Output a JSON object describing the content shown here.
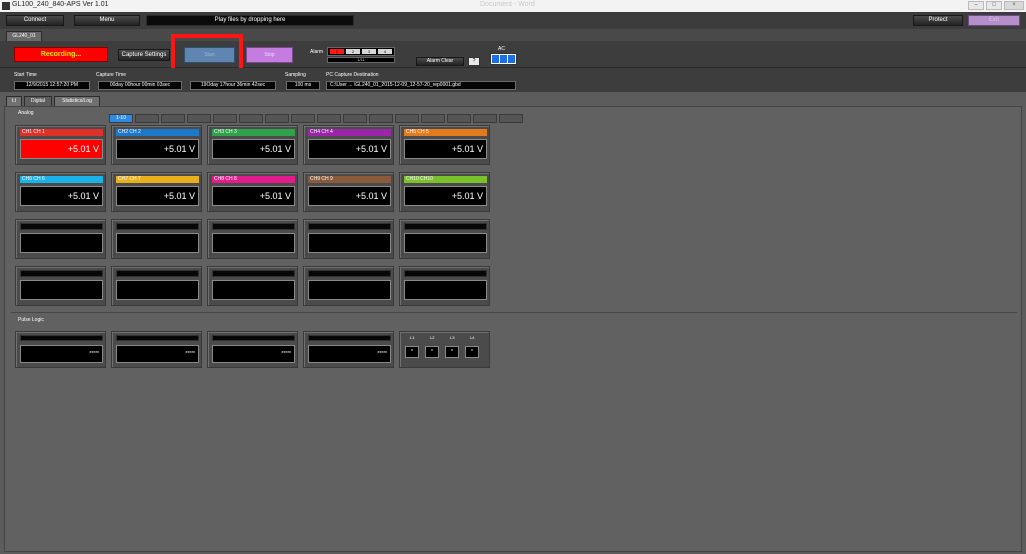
{
  "window": {
    "title": "GL100_240_840-APS Ver 1.01",
    "ghost_title": "Document - Word"
  },
  "toolbar": {
    "connect_label": "Connect",
    "menu_label": "Menu",
    "drop_hint": "Play files by dropping here",
    "protect_label": "Protect",
    "exit_label": "Exit"
  },
  "device_tab": "GL240_01",
  "controls": {
    "status": "Recording...",
    "capture_settings_label": "Capture Settings",
    "start_label": "Start",
    "stop_label": "Stop",
    "alarm_label": "Alarm",
    "alarm_channels": [
      "1",
      "2",
      "3",
      "4"
    ],
    "alarm_sub": "1/11",
    "alarm_clear_label": "Alarm Clear",
    "help_label": "?",
    "ac_label": "AC"
  },
  "info": {
    "start_time_label": "Start Time",
    "start_time": "12/9/2015 12:57:20 PM",
    "capture_time_label": "Capture Time",
    "capture_elapsed": "00day 00hour 00min 03sec",
    "capture_remaining": "19Oday 17hour 36min 42sec",
    "sampling_label": "Sampling",
    "sampling": "100 ms",
    "destination_label": "PC Capture Destination",
    "destination": "C:\\User ... \\GL240_01_2015-12-09_12-57-20_rep0001.gbd"
  },
  "view_tabs": [
    "t.t",
    "Digital",
    "Statistics/Log"
  ],
  "analog": {
    "label": "Analog",
    "page_label": "1-10",
    "channels": [
      {
        "name": "CH1  CH 1",
        "value": "+5.01 V",
        "color": "#e0302a",
        "alarm": true
      },
      {
        "name": "CH2  CH 2",
        "value": "+5.01 V",
        "color": "#1c78c8",
        "alarm": false
      },
      {
        "name": "CH3  CH 3",
        "value": "+5.01 V",
        "color": "#2fa24a",
        "alarm": false
      },
      {
        "name": "CH4  CH 4",
        "value": "+5.01 V",
        "color": "#9b24a8",
        "alarm": false
      },
      {
        "name": "CH5  CH 5",
        "value": "+5.01 V",
        "color": "#e37b1d",
        "alarm": false
      },
      {
        "name": "CH6  CH 6",
        "value": "+5.01 V",
        "color": "#1ab2e8",
        "alarm": false
      },
      {
        "name": "CH7  CH 7",
        "value": "+5.01 V",
        "color": "#e8b01a",
        "alarm": false
      },
      {
        "name": "CH8  CH 8",
        "value": "+5.01 V",
        "color": "#e41b8c",
        "alarm": false
      },
      {
        "name": "CH9  CH 9",
        "value": "+5.01 V",
        "color": "#8a5a3c",
        "alarm": false
      },
      {
        "name": "CH10  CH10",
        "value": "+5.01 V",
        "color": "#7ac12a",
        "alarm": false
      }
    ]
  },
  "pulse_logic": {
    "label": "Pulse Logic",
    "pulse_values": [
      "*****",
      "*****",
      "*****",
      "*****"
    ],
    "logic_labels": [
      "L1",
      "L2",
      "L3",
      "L4"
    ],
    "logic_values": [
      "*",
      "*",
      "*",
      "*"
    ]
  }
}
